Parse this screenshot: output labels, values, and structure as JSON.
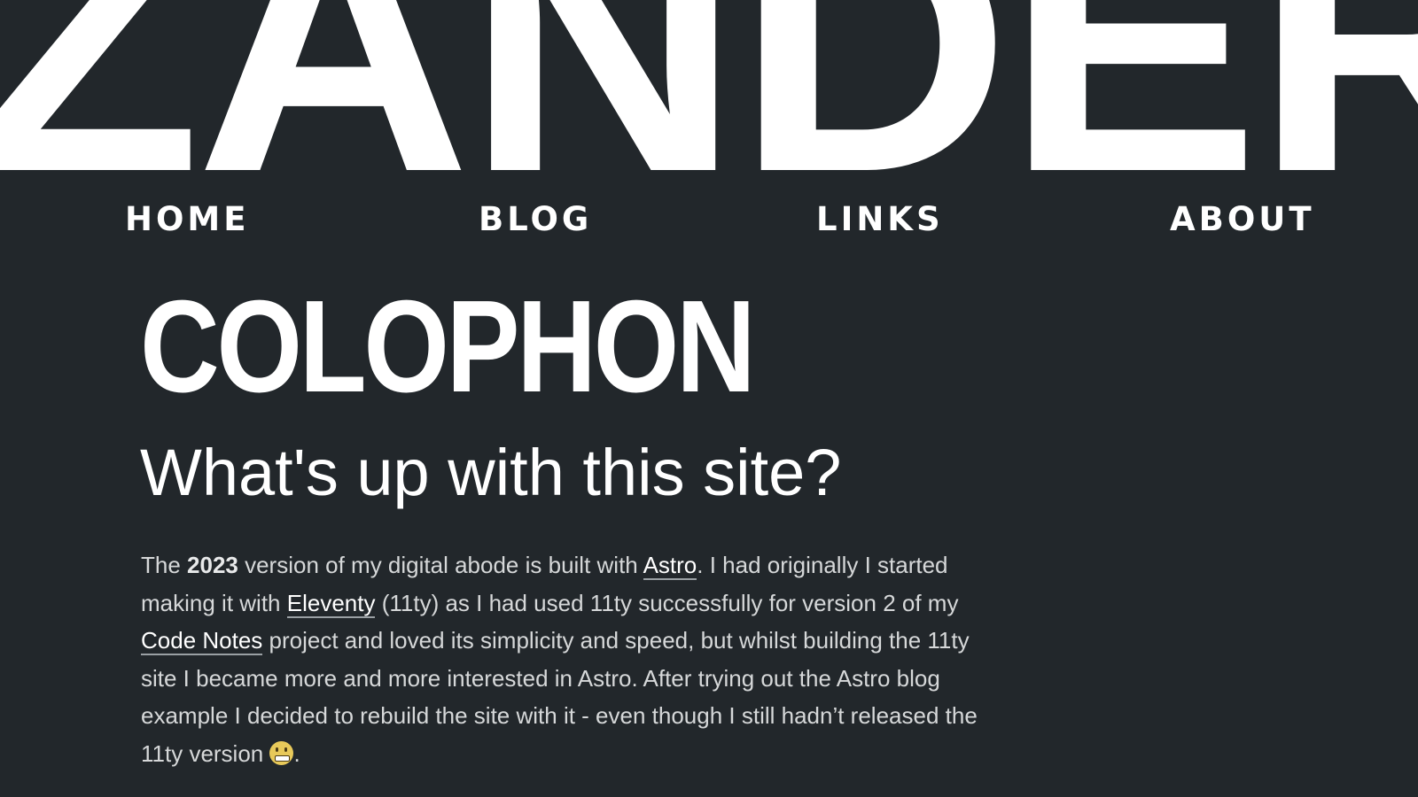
{
  "site": {
    "logo_text": "ZANDER"
  },
  "nav": {
    "items": [
      {
        "label": "HOME"
      },
      {
        "label": "BLOG"
      },
      {
        "label": "LINKS"
      },
      {
        "label": "ABOUT"
      }
    ]
  },
  "page": {
    "title": "COLOPHON",
    "subtitle": "What's up with this site?"
  },
  "content": {
    "p1_the": "The ",
    "p1_year": "2023",
    "p1_a": " version of my digital abode is built with ",
    "p1_link_astro": "Astro",
    "p1_b": ". I had originally I started making it with ",
    "p1_link_eleventy": "Eleventy",
    "p1_c": " (11ty) as I had used 11ty successfully for version 2 of my ",
    "p1_link_codenotes": "Code Notes",
    "p1_d": " project and loved its simplicity and speed, but whilst building the 11ty site I became more and more interested in Astro. After trying out the Astro blog example I decided to rebuild the site with it - even though I still hadn’t released the 11ty version ",
    "p1_emoji_name": "grimacing-face-emoji",
    "p1_end": "."
  },
  "colors": {
    "background": "#22272b",
    "text": "#ffffff",
    "body_text": "#d6d8d9"
  }
}
